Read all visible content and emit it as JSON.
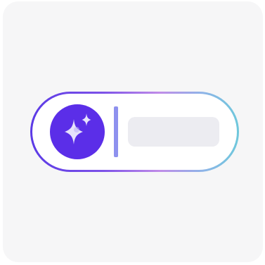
{
  "widget": {
    "ai_icon_name": "sparkles-icon",
    "input_value": "",
    "accent_color": "#5b2ee8",
    "cursor_color": "#8e91ee",
    "gradient_colors": [
      "#5b3ae6",
      "#c08ce8",
      "#6ec8dc"
    ]
  }
}
